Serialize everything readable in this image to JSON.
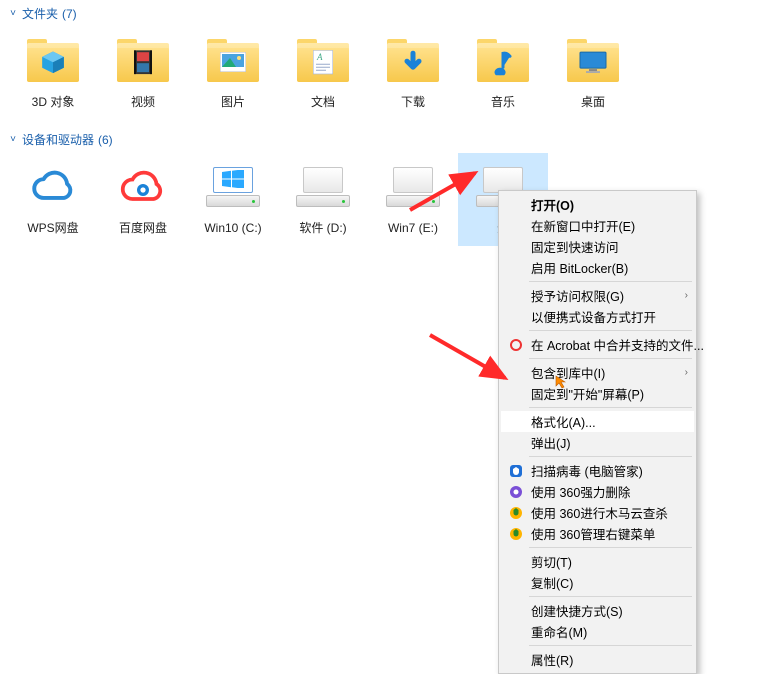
{
  "folders_section": {
    "title": "文件夹",
    "count": "(7)"
  },
  "folders": [
    {
      "label": "3D 对象",
      "overlay": "cube"
    },
    {
      "label": "视频",
      "overlay": "film"
    },
    {
      "label": "图片",
      "overlay": "photo"
    },
    {
      "label": "文档",
      "overlay": "doc"
    },
    {
      "label": "下载",
      "overlay": "download"
    },
    {
      "label": "音乐",
      "overlay": "music"
    },
    {
      "label": "桌面",
      "overlay": "desktop"
    }
  ],
  "drives_section": {
    "title": "设备和驱动器",
    "count": "(6)"
  },
  "drives": [
    {
      "label": "WPS网盘",
      "kind": "wps"
    },
    {
      "label": "百度网盘",
      "kind": "baidu"
    },
    {
      "label": "Win10 (C:)",
      "kind": "win"
    },
    {
      "label": "软件 (D:)",
      "kind": "blank"
    },
    {
      "label": "Win7 (E:)",
      "kind": "blank"
    },
    {
      "label": "影",
      "kind": "blank",
      "selected": true
    }
  ],
  "context_menu": {
    "items": [
      {
        "label": "打开(O)",
        "bold": true
      },
      {
        "label": "在新窗口中打开(E)"
      },
      {
        "label": "固定到快速访问"
      },
      {
        "label": "启用 BitLocker(B)"
      },
      {
        "sep": true
      },
      {
        "label": "授予访问权限(G)",
        "sub": true
      },
      {
        "label": "以便携式设备方式打开"
      },
      {
        "sep": true
      },
      {
        "label": "在 Acrobat 中合并支持的文件...",
        "icon": "acrobat"
      },
      {
        "sep": true
      },
      {
        "label": "包含到库中(I)",
        "sub": true
      },
      {
        "label": "固定到\"开始\"屏幕(P)"
      },
      {
        "sep": true
      },
      {
        "label": "格式化(A)...",
        "highlight": true
      },
      {
        "label": "弹出(J)"
      },
      {
        "sep": true
      },
      {
        "label": "扫描病毒 (电脑管家)",
        "icon": "guanjia"
      },
      {
        "label": "使用 360强力删除",
        "icon": "360purple"
      },
      {
        "label": "使用 360进行木马云查杀",
        "icon": "360yellow"
      },
      {
        "label": "使用 360管理右键菜单",
        "icon": "360yellow"
      },
      {
        "sep": true
      },
      {
        "label": "剪切(T)"
      },
      {
        "label": "复制(C)"
      },
      {
        "sep": true
      },
      {
        "label": "创建快捷方式(S)"
      },
      {
        "label": "重命名(M)"
      },
      {
        "sep": true
      },
      {
        "label": "属性(R)"
      }
    ]
  }
}
